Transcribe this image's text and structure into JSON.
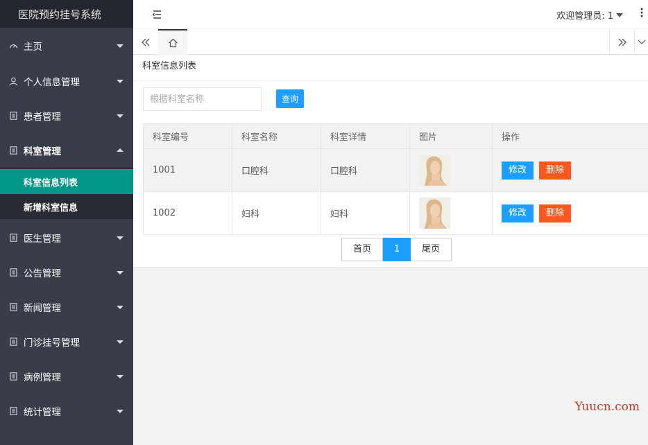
{
  "app": {
    "title": "医院预约挂号系统"
  },
  "sidebar": {
    "items": [
      {
        "label": "主页",
        "icon": "gauge-icon",
        "expanded": false
      },
      {
        "label": "个人信息管理",
        "icon": "user-icon",
        "expanded": false
      },
      {
        "label": "患者管理",
        "icon": "doc-icon",
        "expanded": false
      },
      {
        "label": "科室管理",
        "icon": "doc-icon",
        "expanded": true,
        "children": [
          {
            "label": "科室信息列表",
            "active": true
          },
          {
            "label": "新增科室信息",
            "active": false
          }
        ]
      },
      {
        "label": "医生管理",
        "icon": "doc-icon",
        "expanded": false
      },
      {
        "label": "公告管理",
        "icon": "doc-icon",
        "expanded": false
      },
      {
        "label": "新闻管理",
        "icon": "doc-icon",
        "expanded": false
      },
      {
        "label": "门诊挂号管理",
        "icon": "doc-icon",
        "expanded": false
      },
      {
        "label": "病例管理",
        "icon": "doc-icon",
        "expanded": false
      },
      {
        "label": "统计管理",
        "icon": "doc-icon",
        "expanded": false
      }
    ]
  },
  "header": {
    "welcome": "欢迎管理员: 1"
  },
  "main": {
    "card_title": "科室信息列表",
    "search": {
      "placeholder": "根据科室名称",
      "value": "",
      "button_label": "查询"
    },
    "table": {
      "columns": [
        "科室编号",
        "科室名称",
        "科室详情",
        "图片",
        "操作"
      ],
      "rows": [
        {
          "id": "1001",
          "name": "口腔科",
          "detail": "口腔科",
          "image": "portrait"
        },
        {
          "id": "1002",
          "name": "妇科",
          "detail": "妇科",
          "image": "portrait"
        }
      ],
      "edit_label": "修改",
      "delete_label": "删除"
    },
    "pager": {
      "first": "首页",
      "current": "1",
      "last": "尾页"
    }
  },
  "watermark": "Yuucn.com",
  "colors": {
    "sidebar_bg": "#393d49",
    "sidebar_logo_bg": "#23262e",
    "active_teal": "#009688",
    "primary_blue": "#1e9fff",
    "danger_orange": "#ff5722"
  }
}
